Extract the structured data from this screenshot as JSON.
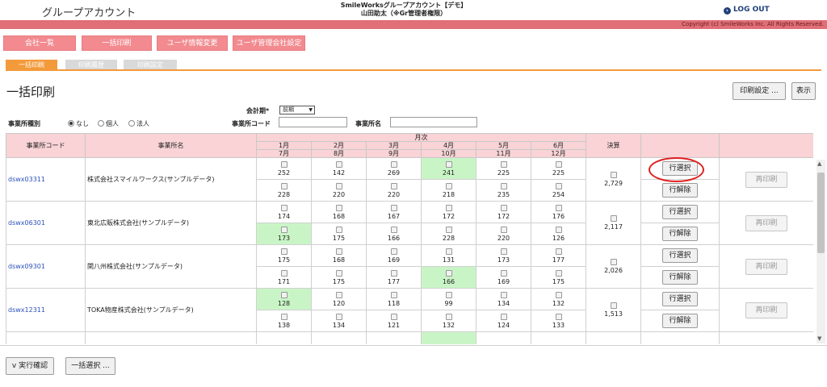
{
  "header": {
    "app_title": "グループアカウント",
    "company_line1": "SmileWorksグループアカウント【デモ】",
    "company_line2": "山田助太（※Gr管理者権限）",
    "logout": "LOG OUT",
    "copyright": "Copyright (c) SmileWorks Inc. All Rights Reserved."
  },
  "nav": [
    "会社一覧",
    "一括印刷",
    "ユーザ情報変更",
    "ユーザ管理会社設定"
  ],
  "tabs": [
    "一括印刷",
    "印刷履歴",
    "印刷設定"
  ],
  "page_title": "一括印刷",
  "top_buttons": {
    "print_settings": "印刷設定 ...",
    "display": "表示"
  },
  "filters": {
    "fiscal_label": "会計期*",
    "fiscal_value": "前期",
    "office_type_label": "事業所種別",
    "radio_none": "なし",
    "radio_individual": "個人",
    "radio_corp": "法人",
    "office_code_label": "事業所コード",
    "office_name_label": "事業所名"
  },
  "table": {
    "col_code": "事業所コード",
    "col_name": "事業所名",
    "col_monthly": "月次",
    "months_top": [
      "1月",
      "2月",
      "3月",
      "4月",
      "5月",
      "6月"
    ],
    "months_bottom": [
      "7月",
      "8月",
      "9月",
      "10月",
      "11月",
      "12月"
    ],
    "col_settlement": "決算",
    "select_row": "行選択",
    "deselect_row": "行解除",
    "reprint": "再印刷",
    "rows": [
      {
        "code": "dswx03311",
        "name": "株式会社スマイルワークス(サンプルデータ)",
        "top": [
          "252",
          "142",
          "269",
          "241",
          "225",
          "225"
        ],
        "bottom": [
          "228",
          "220",
          "220",
          "218",
          "235",
          "254"
        ],
        "settlement": "2,729"
      },
      {
        "code": "dswx06301",
        "name": "東北広販株式会社(サンプルデータ)",
        "top": [
          "174",
          "168",
          "167",
          "172",
          "172",
          "176"
        ],
        "bottom": [
          "173",
          "175",
          "166",
          "228",
          "220",
          "126"
        ],
        "settlement": "2,117"
      },
      {
        "code": "dswx09301",
        "name": "関八州株式会社(サンプルデータ)",
        "top": [
          "175",
          "168",
          "169",
          "131",
          "173",
          "177"
        ],
        "bottom": [
          "171",
          "175",
          "177",
          "166",
          "169",
          "175"
        ],
        "settlement": "2,026"
      },
      {
        "code": "dswx12311",
        "name": "TOKA物産株式会社(サンプルデータ)",
        "top": [
          "128",
          "120",
          "118",
          "99",
          "134",
          "132"
        ],
        "bottom": [
          "138",
          "134",
          "121",
          "132",
          "124",
          "133"
        ],
        "settlement": "1,513"
      }
    ]
  },
  "footer": {
    "execute_confirm": "v 実行確認",
    "bulk_select": "一括選択 ..."
  }
}
